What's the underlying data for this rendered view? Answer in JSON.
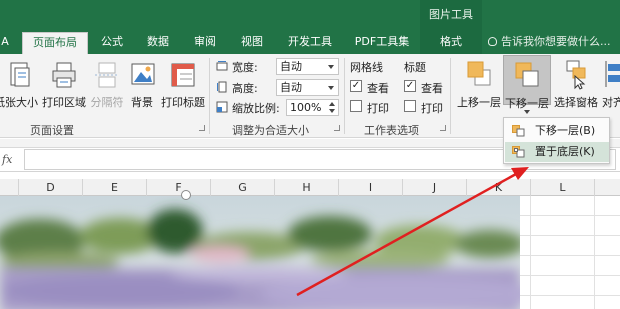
{
  "contextual_tab_group": "图片工具",
  "tabs": [
    {
      "label": "A"
    },
    {
      "label": "页面布局",
      "active": true
    },
    {
      "label": "公式"
    },
    {
      "label": "数据"
    },
    {
      "label": "审阅"
    },
    {
      "label": "视图"
    },
    {
      "label": "开发工具"
    },
    {
      "label": "PDF工具集"
    },
    {
      "label": "格式"
    }
  ],
  "tell_me": "告诉我你想要做什么...",
  "page_setup": {
    "size_label": "纸张大小",
    "print_area_label": "打印区域",
    "breaks_label": "分隔符",
    "background_label": "背景",
    "print_titles_label": "打印标题",
    "group_label": "页面设置"
  },
  "scale_to_fit": {
    "width_label": "宽度:",
    "width_value": "自动",
    "height_label": "高度:",
    "height_value": "自动",
    "scale_label": "缩放比例:",
    "scale_value": "100%",
    "group_label": "调整为合适大小"
  },
  "sheet_options": {
    "gridlines_label": "网格线",
    "headings_label": "标题",
    "view_label": "查看",
    "print_label": "打印",
    "gridlines_view": true,
    "gridlines_print": false,
    "headings_view": true,
    "headings_print": false,
    "group_label": "工作表选项"
  },
  "arrange": {
    "bring_forward_label": "上移一层",
    "send_backward_label": "下移一层",
    "selection_pane_label": "选择窗格",
    "align_label": "对齐"
  },
  "dropdown": {
    "send_backward": "下移一层(B)",
    "send_to_back": "置于底层(K)"
  },
  "formula_bar": {
    "fx": "fx",
    "value": ""
  },
  "columns": [
    "D",
    "E",
    "F",
    "G",
    "H",
    "I",
    "J",
    "K",
    "L"
  ],
  "colors": {
    "tab_bar": "#217346",
    "ribbon": "#f3f3f3",
    "annotation_arrow": "#e02020"
  }
}
